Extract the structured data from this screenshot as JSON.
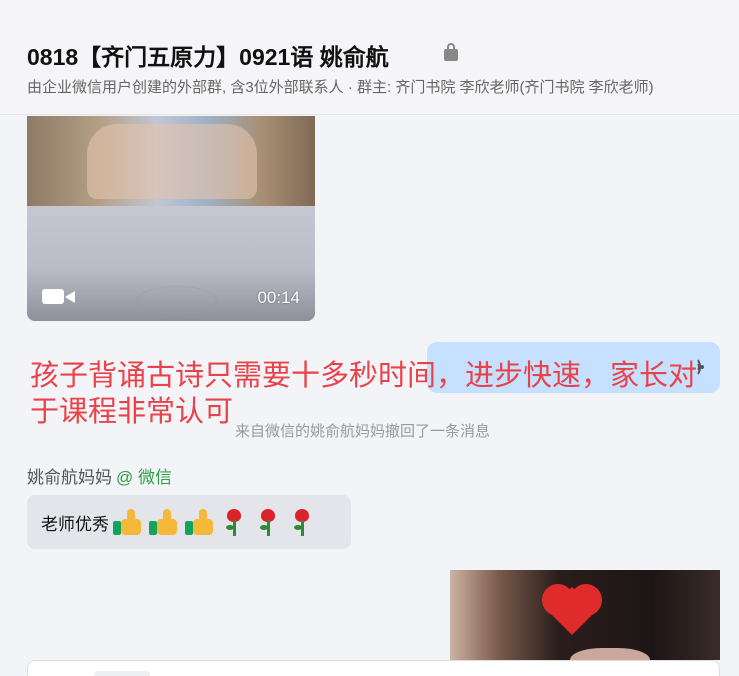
{
  "header": {
    "title": "0818【齐门五原力】0921语 姚俞航",
    "description": "由企业微信用户创建的外部群, 含3位外部联系人 · 群主: 齐门书院 李欣老师(齐门书院 李欣老师)"
  },
  "messages": {
    "video": {
      "duration": "00:14"
    },
    "recall_notice": "来自微信的姚俞航妈妈撤回了一条消息",
    "incoming": {
      "sender_name": "姚俞航妈妈",
      "sender_source": "@ 微信",
      "text": "老师优秀"
    }
  },
  "overlay": {
    "caption": "孩子背诵古诗只需要十多秒时间，进步快速，家长对于课程非常认可"
  },
  "colors": {
    "caption": "#e8434a",
    "outgoing_bubble": "#c6e0ff",
    "incoming_bubble": "#e4e5ea",
    "wechat_tag": "#2ea043"
  },
  "icons": [
    "lock-icon",
    "video-camera-icon",
    "voice-icon",
    "thumbs-up-icon",
    "rose-icon",
    "heart-icon"
  ]
}
